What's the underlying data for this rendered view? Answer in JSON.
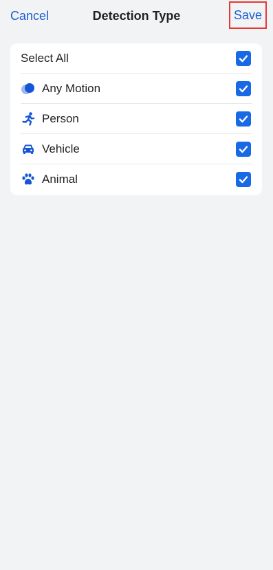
{
  "navbar": {
    "cancel_label": "Cancel",
    "title": "Detection Type",
    "save_label": "Save"
  },
  "list": {
    "items": [
      {
        "label": "Select All",
        "icon": "",
        "checked": true
      },
      {
        "label": "Any Motion",
        "icon": "motion-icon",
        "checked": true
      },
      {
        "label": "Person",
        "icon": "running-person-icon",
        "checked": true
      },
      {
        "label": "Vehicle",
        "icon": "car-icon",
        "checked": true
      },
      {
        "label": "Animal",
        "icon": "paw-icon",
        "checked": true
      }
    ]
  },
  "colors": {
    "accent": "#1a5fd0",
    "checkbox": "#1769e6",
    "save_highlight": "#e53935",
    "background": "#f2f3f5"
  }
}
